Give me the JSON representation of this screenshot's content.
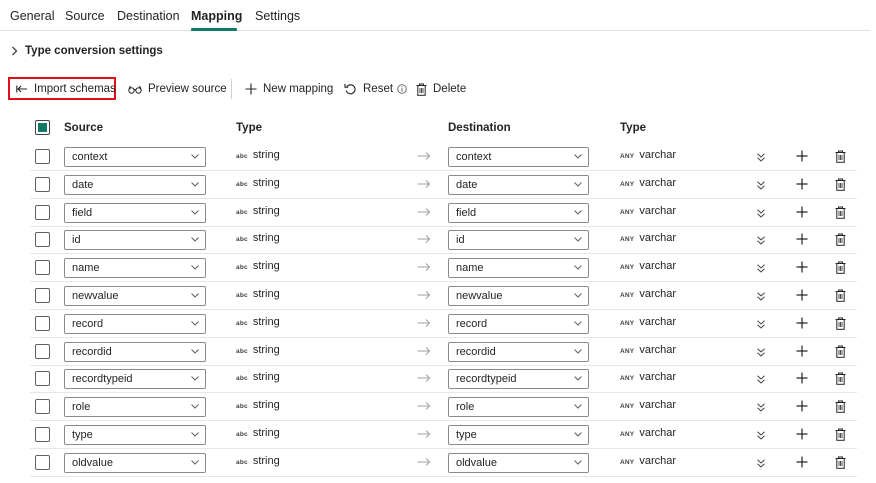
{
  "tabs": [
    {
      "label": "General"
    },
    {
      "label": "Source"
    },
    {
      "label": "Destination"
    },
    {
      "label": "Mapping"
    },
    {
      "label": "Settings"
    }
  ],
  "active_tab": "Mapping",
  "type_conversion": {
    "label": "Type conversion settings"
  },
  "toolbar": {
    "import_schemas": "Import schemas",
    "preview_source": "Preview source",
    "new_mapping": "New mapping",
    "reset": "Reset",
    "delete": "Delete"
  },
  "columns": {
    "source": "Source",
    "source_type": "Type",
    "destination": "Destination",
    "destination_type": "Type"
  },
  "type_badges": {
    "source": "abc",
    "destination": "ANY"
  },
  "rows": [
    {
      "source": "context",
      "source_type": "string",
      "destination": "context",
      "destination_type": "varchar"
    },
    {
      "source": "date",
      "source_type": "string",
      "destination": "date",
      "destination_type": "varchar"
    },
    {
      "source": "field",
      "source_type": "string",
      "destination": "field",
      "destination_type": "varchar"
    },
    {
      "source": "id",
      "source_type": "string",
      "destination": "id",
      "destination_type": "varchar"
    },
    {
      "source": "name",
      "source_type": "string",
      "destination": "name",
      "destination_type": "varchar"
    },
    {
      "source": "newvalue",
      "source_type": "string",
      "destination": "newvalue",
      "destination_type": "varchar"
    },
    {
      "source": "record",
      "source_type": "string",
      "destination": "record",
      "destination_type": "varchar"
    },
    {
      "source": "recordid",
      "source_type": "string",
      "destination": "recordid",
      "destination_type": "varchar"
    },
    {
      "source": "recordtypeid",
      "source_type": "string",
      "destination": "recordtypeid",
      "destination_type": "varchar"
    },
    {
      "source": "role",
      "source_type": "string",
      "destination": "role",
      "destination_type": "varchar"
    },
    {
      "source": "type",
      "source_type": "string",
      "destination": "type",
      "destination_type": "varchar"
    },
    {
      "source": "oldvalue",
      "source_type": "string",
      "destination": "oldvalue",
      "destination_type": "varchar"
    }
  ],
  "colors": {
    "accent": "#117865",
    "highlight": "#e0101a"
  }
}
